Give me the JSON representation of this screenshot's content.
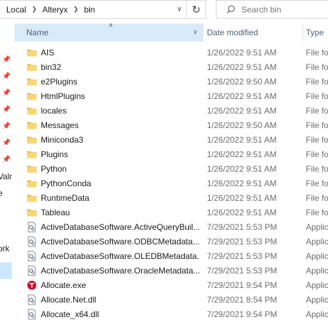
{
  "address": {
    "breadcrumbs": [
      "Local",
      "Alteryx",
      "bin"
    ]
  },
  "search": {
    "placeholder": "Search bin"
  },
  "columns": {
    "name": "Name",
    "date": "Date modified",
    "type": "Type"
  },
  "nav": {
    "fragments": [
      "Valr",
      "e",
      "ork"
    ]
  },
  "files": [
    {
      "name": "AIS",
      "date": "1/26/2022 9:51 AM",
      "type": "File fo",
      "icon": "folder-icon"
    },
    {
      "name": "bin32",
      "date": "1/26/2022 9:51 AM",
      "type": "File fo",
      "icon": "folder-icon"
    },
    {
      "name": "e2Plugins",
      "date": "1/26/2022 9:50 AM",
      "type": "File fo",
      "icon": "folder-icon"
    },
    {
      "name": "HtmlPlugins",
      "date": "1/26/2022 9:51 AM",
      "type": "File fo",
      "icon": "folder-icon"
    },
    {
      "name": "locales",
      "date": "1/26/2022 9:51 AM",
      "type": "File fo",
      "icon": "folder-icon"
    },
    {
      "name": "Messages",
      "date": "1/26/2022 9:50 AM",
      "type": "File fo",
      "icon": "folder-icon"
    },
    {
      "name": "Miniconda3",
      "date": "1/26/2022 9:51 AM",
      "type": "File fo",
      "icon": "folder-icon"
    },
    {
      "name": "Plugins",
      "date": "1/26/2022 9:51 AM",
      "type": "File fo",
      "icon": "folder-icon"
    },
    {
      "name": "Python",
      "date": "1/26/2022 9:51 AM",
      "type": "File fo",
      "icon": "folder-icon"
    },
    {
      "name": "PythonConda",
      "date": "1/26/2022 9:51 AM",
      "type": "File fo",
      "icon": "folder-icon"
    },
    {
      "name": "RuntimeData",
      "date": "1/26/2022 9:51 AM",
      "type": "File fo",
      "icon": "folder-icon"
    },
    {
      "name": "Tableau",
      "date": "1/26/2022 9:51 AM",
      "type": "File fo",
      "icon": "folder-icon"
    },
    {
      "name": "ActiveDatabaseSoftware.ActiveQueryBuil...",
      "date": "7/29/2021 5:53 PM",
      "type": "Applic",
      "icon": "dll-file-icon"
    },
    {
      "name": "ActiveDatabaseSoftware.ODBCMetadata...",
      "date": "7/29/2021 5:53 PM",
      "type": "Applic",
      "icon": "dll-file-icon"
    },
    {
      "name": "ActiveDatabaseSoftware.OLEDBMetadata...",
      "date": "7/29/2021 5:53 PM",
      "type": "Applic",
      "icon": "dll-file-icon"
    },
    {
      "name": "ActiveDatabaseSoftware.OracleMetadata...",
      "date": "7/29/2021 5:53 PM",
      "type": "Applic",
      "icon": "dll-file-icon"
    },
    {
      "name": "Allocate.exe",
      "date": "7/29/2021 9:54 PM",
      "type": "Applic",
      "icon": "exe-app-icon"
    },
    {
      "name": "Allocate.Net.dll",
      "date": "7/29/2021 8:54 PM",
      "type": "Applic",
      "icon": "dll-file-icon"
    },
    {
      "name": "Allocate_x64.dll",
      "date": "7/29/2021 9:54 PM",
      "type": "Applic",
      "icon": "dll-file-icon"
    }
  ],
  "colors": {
    "folder": "#f8d775",
    "header_selected": "#d9ebf9",
    "nav_selected": "#cce8ff",
    "exe_accent": "#c8102e"
  }
}
